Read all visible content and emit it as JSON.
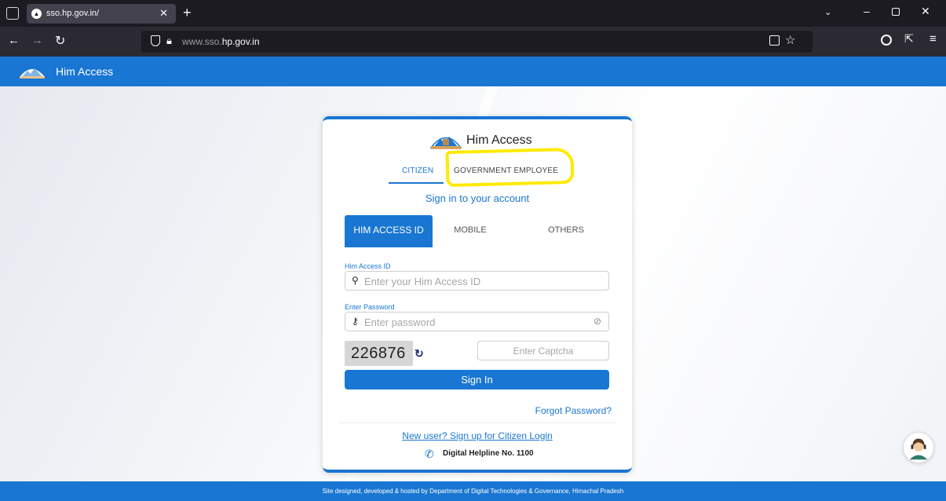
{
  "browser": {
    "tab_title": "sso.hp.gov.in/",
    "url_prefix": "www.sso.",
    "url_domain": "hp.gov.in"
  },
  "header": {
    "title": "Him Access"
  },
  "card": {
    "title": "Him Access",
    "roles": [
      "CITIZEN",
      "GOVERNMENT EMPLOYEE"
    ],
    "signin_heading": "Sign in to your account",
    "methods": [
      "HIM ACCESS ID",
      "MOBILE",
      "OTHERS"
    ],
    "id_label": "Him Access ID",
    "id_placeholder": "Enter your Him Access ID",
    "password_label": "Enter Password",
    "password_placeholder": "Enter password",
    "captcha_value": "226876",
    "captcha_placeholder": "Enter Captcha",
    "signin_button": "Sign In",
    "forgot_password": "Forgot Password?",
    "signup_link": "New user? Sign up for Citizen Login",
    "helpline": "Digital Helpline No. 1100"
  },
  "footer": {
    "text": "Site designed, developed & hosted by Department of Digital Technologies & Governance, Himachal Pradesh"
  },
  "colors": {
    "brand": "#1976d2",
    "highlight": "#ffea00",
    "browser_dark": "#1c1b22"
  },
  "icons": [
    "tab-list-icon",
    "close-icon",
    "plus-icon",
    "back-icon",
    "forward-icon",
    "reload-icon",
    "shield-icon",
    "lock-icon",
    "reader-icon",
    "star-icon",
    "account-icon",
    "extensions-icon",
    "menu-icon",
    "user-icon",
    "key-icon",
    "eye-off-icon",
    "refresh-icon",
    "phone-icon",
    "support-agent-icon"
  ]
}
